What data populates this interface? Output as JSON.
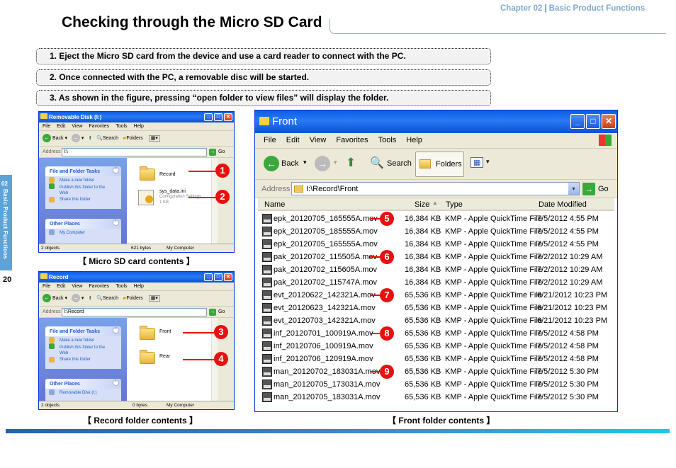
{
  "header": {
    "chapter": "Chapter 02",
    "chapter_title": "Basic Product Functions"
  },
  "page_title": "Checking through the Micro SD Card",
  "steps": [
    "1. Eject the Micro SD card from the device and use a card reader to connect with the PC.",
    "2. Once connected with the PC, a removable disc will be started.",
    "3. As shown in the figure, pressing “open folder to view files” will display the folder."
  ],
  "side_tab": {
    "number": "02",
    "label": "Basic Product Functions"
  },
  "page_number": "20",
  "captions": {
    "sd": "【 Micro SD card contents 】",
    "record": "【 Record folder contents 】",
    "front": "【 Front folder contents 】"
  },
  "menu": [
    "File",
    "Edit",
    "View",
    "Favorites",
    "Tools",
    "Help"
  ],
  "toolbar": {
    "back": "Back",
    "search": "Search",
    "folders": "Folders",
    "go": "Go",
    "address_label": "Address"
  },
  "task_panel": {
    "file_tasks": "File and Folder Tasks",
    "tasks": [
      "Make a new folder",
      "Publish this folder to the Web",
      "Share this folder"
    ],
    "other_places": "Other Places"
  },
  "sd_window": {
    "title": "Removable Disk (I:)",
    "address": "I:\\",
    "other_link": "My Computer",
    "items": [
      {
        "name": "Record",
        "marker": "1"
      },
      {
        "name": "sys_data.ini",
        "sub1": "Configuration Settings",
        "sub2": "1 KB",
        "marker": "2"
      }
    ],
    "status": {
      "objects": "2 objects",
      "size": "621 bytes",
      "location": "My Computer"
    }
  },
  "record_window": {
    "title": "Record",
    "address": "I:\\Record",
    "other_link": "Removable Disk (I:)",
    "items": [
      {
        "name": "Front",
        "marker": "3"
      },
      {
        "name": "Rear",
        "marker": "4"
      }
    ],
    "status": {
      "objects": "2 objects",
      "size": "0 bytes",
      "location": "My Computer"
    }
  },
  "front_window": {
    "title": "Front",
    "address": "I:\\Record\\Front",
    "columns": [
      "Name",
      "Size",
      "Type",
      "Date Modified"
    ],
    "files": [
      {
        "name": "epk_20120705_165555A.mov",
        "size": "16,384 KB",
        "type": "KMP - Apple QuickTime File",
        "date": "7/5/2012 4:55 PM",
        "marker": "5"
      },
      {
        "name": "epk_20120705_185555A.mov",
        "size": "16,384 KB",
        "type": "KMP - Apple QuickTime File",
        "date": "7/5/2012 4:55 PM",
        "marker": ""
      },
      {
        "name": "epk_20120705_165555A.mov",
        "size": "16,384 KB",
        "type": "KMP - Apple QuickTime File",
        "date": "7/5/2012 4:55 PM",
        "marker": ""
      },
      {
        "name": "pak_20120702_115505A.mov",
        "size": "16,384 KB",
        "type": "KMP - Apple QuickTime File",
        "date": "7/2/2012 10:29 AM",
        "marker": "6"
      },
      {
        "name": "pak_20120702_115605A.mov",
        "size": "16,384 KB",
        "type": "KMP - Apple QuickTime File",
        "date": "7/2/2012 10:29 AM",
        "marker": ""
      },
      {
        "name": "pak_20120702_115747A.mov",
        "size": "16,384 KB",
        "type": "KMP - Apple QuickTime File",
        "date": "7/2/2012 10:29 AM",
        "marker": ""
      },
      {
        "name": "evt_20120622_142321A.mov",
        "size": "65,536 KB",
        "type": "KMP - Apple QuickTime File",
        "date": "6/21/2012 10:23 PM",
        "marker": "7"
      },
      {
        "name": "evt_20120623_142321A.mov",
        "size": "65,536 KB",
        "type": "KMP - Apple QuickTime File",
        "date": "6/21/2012 10:23 PM",
        "marker": ""
      },
      {
        "name": "evt_20120703_142321A.mov",
        "size": "65,536 KB",
        "type": "KMP - Apple QuickTime File",
        "date": "6/21/2012 10:23 PM",
        "marker": ""
      },
      {
        "name": "inf_20120701_100919A.mov",
        "size": "65,536 KB",
        "type": "KMP - Apple QuickTime File",
        "date": "7/5/2012 4:58 PM",
        "marker": "8"
      },
      {
        "name": "inf_20120706_100919A.mov",
        "size": "65,536 KB",
        "type": "KMP - Apple QuickTime File",
        "date": "7/5/2012 4:58 PM",
        "marker": ""
      },
      {
        "name": "inf_20120706_120919A.mov",
        "size": "65,536 KB",
        "type": "KMP - Apple QuickTime File",
        "date": "7/5/2012 4:58 PM",
        "marker": ""
      },
      {
        "name": "man_20120702_183031A.mov",
        "size": "65,536 KB",
        "type": "KMP - Apple QuickTime File",
        "date": "7/5/2012 5:30 PM",
        "marker": "9"
      },
      {
        "name": "man_20120705_173031A.mov",
        "size": "65,536 KB",
        "type": "KMP - Apple QuickTime File",
        "date": "7/5/2012 5:30 PM",
        "marker": ""
      },
      {
        "name": "man_20120705_183031A.mov",
        "size": "65,536 KB",
        "type": "KMP - Apple QuickTime File",
        "date": "7/5/2012 5:30 PM",
        "marker": ""
      }
    ]
  },
  "colors": {
    "accent": "#4a88c8",
    "marker_red": "#e81010",
    "xp_title": "#0a5fe8"
  }
}
